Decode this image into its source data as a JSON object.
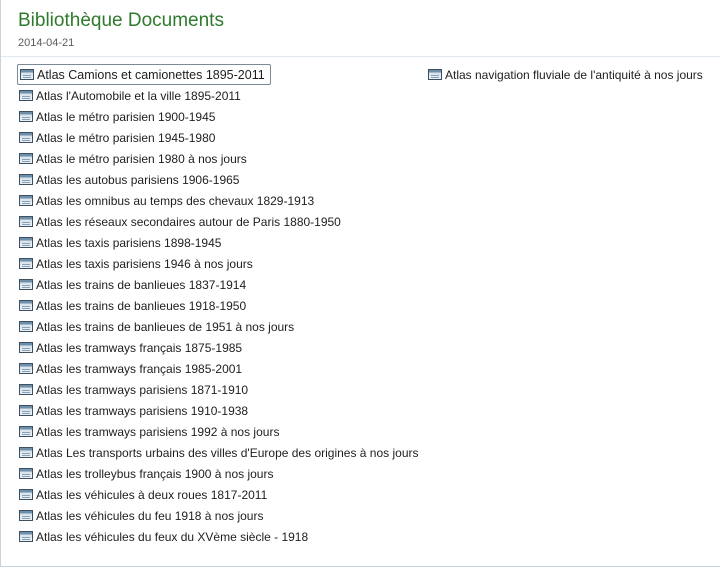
{
  "header": {
    "title": "Bibliothèque Documents",
    "date": "2014-04-21"
  },
  "documents_left": [
    {
      "label": "Atlas Camions et camionettes 1895-2011",
      "selected": true
    },
    {
      "label": "Atlas l'Automobile et la ville 1895-2011"
    },
    {
      "label": "Atlas le métro parisien 1900-1945"
    },
    {
      "label": "Atlas le métro parisien 1945-1980"
    },
    {
      "label": "Atlas le métro parisien 1980 à nos jours"
    },
    {
      "label": "Atlas les autobus parisiens 1906-1965"
    },
    {
      "label": "Atlas les omnibus au temps des chevaux 1829-1913"
    },
    {
      "label": "Atlas les réseaux secondaires autour de Paris 1880-1950"
    },
    {
      "label": "Atlas les taxis parisiens 1898-1945"
    },
    {
      "label": "Atlas les taxis parisiens 1946 à nos jours"
    },
    {
      "label": "Atlas les trains de banlieues 1837-1914"
    },
    {
      "label": "Atlas les trains de banlieues 1918-1950"
    },
    {
      "label": "Atlas les trains de banlieues de 1951 à nos jours"
    },
    {
      "label": "Atlas les tramways français 1875-1985"
    },
    {
      "label": "Atlas les tramways français 1985-2001"
    },
    {
      "label": "Atlas les tramways parisiens 1871-1910"
    },
    {
      "label": "Atlas les tramways parisiens 1910-1938"
    },
    {
      "label": "Atlas les tramways parisiens 1992 à nos jours"
    },
    {
      "label": "Atlas Les transports urbains des villes d'Europe des origines à nos jours"
    },
    {
      "label": "Atlas les trolleybus français 1900 à nos jours"
    },
    {
      "label": "Atlas les véhicules à deux roues 1817-2011"
    },
    {
      "label": "Atlas les véhicules du feu 1918 à nos jours"
    },
    {
      "label": "Atlas les véhicules du feux du XVème siècle - 1918"
    }
  ],
  "documents_right": [
    {
      "label": "Atlas navigation fluviale de l'antiquité à nos jours"
    }
  ],
  "icons": {
    "document": "document-icon"
  },
  "colors": {
    "title": "#2f7a2d",
    "selection_border": "#7a8a99"
  }
}
